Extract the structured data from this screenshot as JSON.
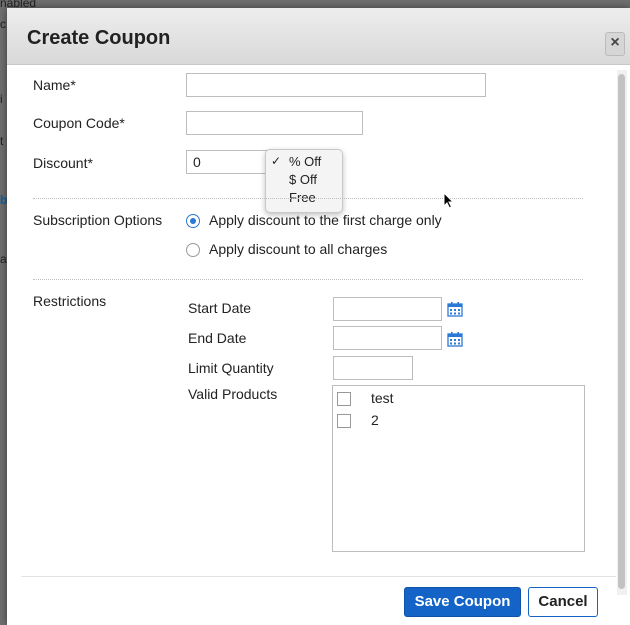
{
  "background": {
    "top_fragment": "nabled",
    "side_fragments": [
      "c",
      "i",
      "t",
      "b",
      "a"
    ]
  },
  "dialog": {
    "title": "Create Coupon",
    "close_label": "×"
  },
  "form": {
    "name_label": "Name*",
    "name_value": "",
    "coupon_code_label": "Coupon Code*",
    "coupon_code_value": "",
    "discount_label": "Discount*",
    "discount_value": "0",
    "discount_type_options": [
      {
        "label": "% Off",
        "selected": true
      },
      {
        "label": "$ Off",
        "selected": false
      },
      {
        "label": "Free",
        "selected": false
      }
    ],
    "discount_checkmark": "✓"
  },
  "subscription": {
    "label": "Subscription Options",
    "options": [
      {
        "label": "Apply discount to the first charge only",
        "checked": true
      },
      {
        "label": "Apply discount to all charges",
        "checked": false
      }
    ]
  },
  "restrictions": {
    "label": "Restrictions",
    "start_date_label": "Start Date",
    "start_date_value": "",
    "end_date_label": "End Date",
    "end_date_value": "",
    "limit_quantity_label": "Limit Quantity",
    "limit_quantity_value": "",
    "valid_products_label": "Valid Products",
    "products": [
      {
        "name": "test",
        "checked": false
      },
      {
        "name": "2",
        "checked": false
      }
    ]
  },
  "footer": {
    "save_label": "Save Coupon",
    "cancel_label": "Cancel"
  },
  "colors": {
    "primary": "#1464c8",
    "accent": "#2b78d5"
  }
}
